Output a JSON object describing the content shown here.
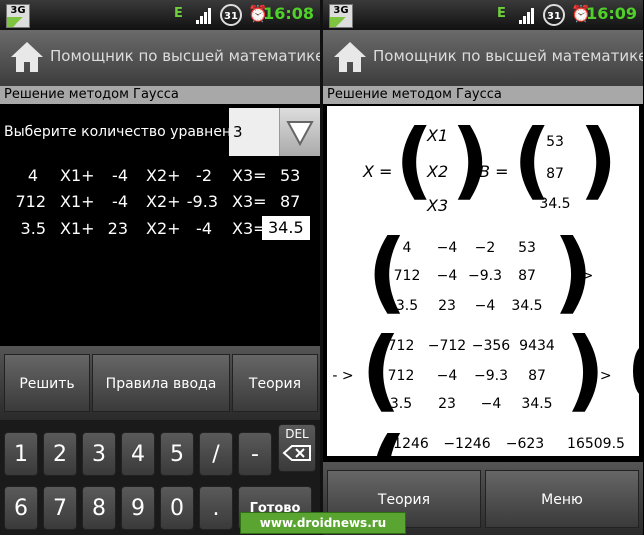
{
  "status": {
    "network": "3G",
    "data_type": "E",
    "battery_left": "31",
    "battery_right": "31",
    "time_left": "16:08",
    "time_right": "16:09"
  },
  "app": {
    "title": "Помощник по высшей математике Lite",
    "subtitle": "Решение методом Гаусса"
  },
  "left": {
    "eq_count_label": "Выберите количество уравнений:",
    "eq_count_value": "3",
    "rows": [
      {
        "c": "4",
        "x1": "X1+",
        "a2": "-4",
        "x2": "X2+",
        "a3": "-2",
        "x3": "X3=",
        "b": "53"
      },
      {
        "c": "712",
        "x1": "X1+",
        "a2": "-4",
        "x2": "X2+",
        "a3": "-9.3",
        "x3": "X3=",
        "b": "87"
      },
      {
        "c": "3.5",
        "x1": "X1+",
        "a2": "23",
        "x2": "X2+",
        "a3": "-4",
        "x3": "X3=",
        "b": "34.5"
      }
    ],
    "buttons": {
      "solve": "Решить",
      "rules": "Правила ввода",
      "theory": "Теория"
    },
    "keys_row1": [
      "1",
      "2",
      "3",
      "4",
      "5",
      "/",
      "-"
    ],
    "keys_row2": [
      "6",
      "7",
      "8",
      "9",
      "0",
      "."
    ],
    "del_key": "DEL",
    "done_key": "Готово"
  },
  "right": {
    "x_label": "X =",
    "x_vector": [
      "X1",
      "X2",
      "X3"
    ],
    "b_label": "B =",
    "b_vector": [
      "53",
      "87",
      "34.5"
    ],
    "matrix1": [
      [
        "4",
        "−4",
        "−2",
        "53"
      ],
      [
        "712",
        "−4",
        "−9.3",
        "87"
      ],
      [
        "3.5",
        "23",
        "−4",
        "34.5"
      ]
    ],
    "matrix2": [
      [
        "712",
        "−712",
        "−356",
        "9434"
      ],
      [
        "712",
        "−4",
        "−9.3",
        "87"
      ],
      [
        "3.5",
        "23",
        "−4",
        "34.5"
      ]
    ],
    "matrix3_row": [
      "1246",
      "−1246",
      "−623",
      "16509.5"
    ],
    "arrow": "->",
    "arrow_prefix": "- >",
    "buttons": {
      "theory": "Теория",
      "menu": "Меню"
    }
  },
  "watermark": "www.droidnews.ru"
}
